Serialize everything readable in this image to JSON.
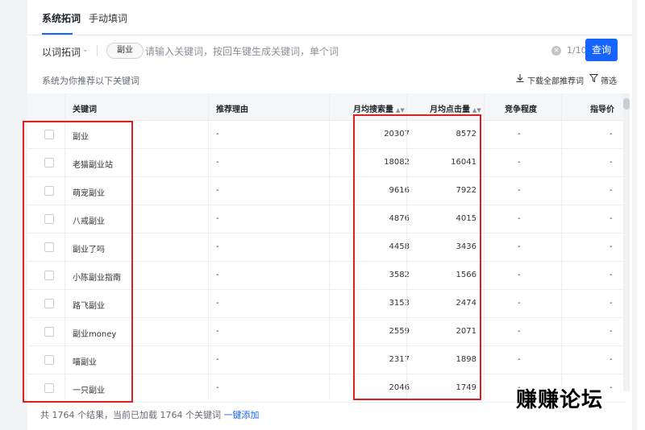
{
  "tabs": [
    {
      "label": "系统拓词",
      "active": true
    },
    {
      "label": "手动填词",
      "active": false
    }
  ],
  "search": {
    "mode_label": "以词拓词",
    "chip_label": "副业",
    "placeholder": "请输入关键词，按回车键生成关键词，单个词",
    "count": "1/10",
    "query_label": "查询"
  },
  "suggest": {
    "text": "系统为你推荐以下关键词",
    "download_label": "下载全部推荐词",
    "filter_label": "筛选"
  },
  "table": {
    "headers": {
      "keyword": "关键词",
      "reason": "推荐理由",
      "search": "月均搜索量",
      "click": "月均点击量",
      "competition": "竞争程度",
      "price": "指导价"
    },
    "rows": [
      {
        "keyword": "副业",
        "reason": "-",
        "search": "20307",
        "click": "8572",
        "competition": "-",
        "price": "-"
      },
      {
        "keyword": "老猫副业站",
        "reason": "-",
        "search": "18082",
        "click": "16041",
        "competition": "-",
        "price": "-"
      },
      {
        "keyword": "萌宠副业",
        "reason": "-",
        "search": "9616",
        "click": "7922",
        "competition": "-",
        "price": "-"
      },
      {
        "keyword": "八戒副业",
        "reason": "-",
        "search": "4876",
        "click": "4015",
        "competition": "-",
        "price": "-"
      },
      {
        "keyword": "副业了吗",
        "reason": "-",
        "search": "4458",
        "click": "3436",
        "competition": "-",
        "price": "-"
      },
      {
        "keyword": "小陈副业指南",
        "reason": "-",
        "search": "3582",
        "click": "1566",
        "competition": "-",
        "price": "-"
      },
      {
        "keyword": "路飞副业",
        "reason": "-",
        "search": "3153",
        "click": "2474",
        "competition": "-",
        "price": "-"
      },
      {
        "keyword": "副业money",
        "reason": "-",
        "search": "2559",
        "click": "2071",
        "competition": "-",
        "price": "-"
      },
      {
        "keyword": "喵副业",
        "reason": "-",
        "search": "2317",
        "click": "1898",
        "competition": "-",
        "price": "-"
      },
      {
        "keyword": "一只副业",
        "reason": "-",
        "search": "2046",
        "click": "1749",
        "competition": "-",
        "price": "-"
      }
    ]
  },
  "footer": {
    "summary": "共 1764 个结果，当前已加载 1764 个关键词",
    "add_all_label": "一键添加"
  },
  "watermark": "赚赚论坛",
  "colors": {
    "accent": "#1664ff",
    "highlight": "#e02020"
  }
}
